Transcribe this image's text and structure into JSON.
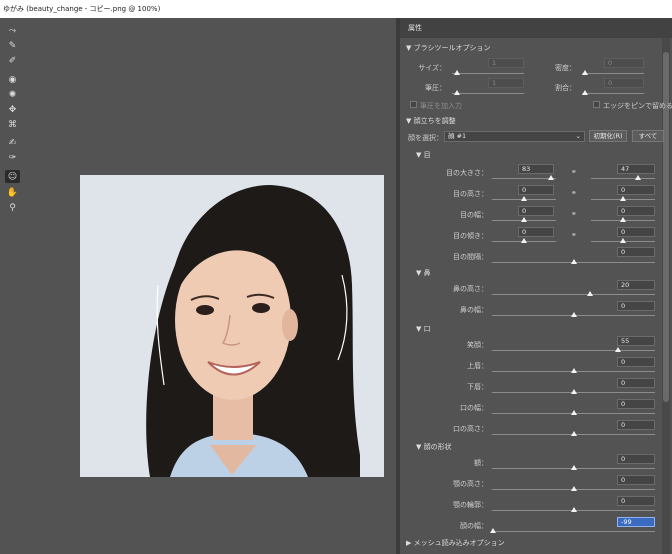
{
  "window": {
    "title": "ゆがみ (beauty_change - コピー.png @ 100%)"
  },
  "tools": [
    {
      "name": "forward-warp-icon",
      "glyph": "⤳"
    },
    {
      "name": "reconstruct-icon",
      "glyph": "✎"
    },
    {
      "name": "smooth-icon",
      "glyph": "✐"
    },
    {
      "name": "twirl-icon",
      "glyph": "◉"
    },
    {
      "name": "pucker-icon",
      "glyph": "✺"
    },
    {
      "name": "bloat-icon",
      "glyph": "✥"
    },
    {
      "name": "push-left-icon",
      "glyph": "⌘"
    },
    {
      "name": "freeze-mask-icon",
      "glyph": "✍"
    },
    {
      "name": "thaw-mask-icon",
      "glyph": "✑"
    },
    {
      "name": "face-tool-icon",
      "glyph": "☺"
    },
    {
      "name": "hand-icon",
      "glyph": "✋"
    },
    {
      "name": "zoom-icon",
      "glyph": "⚲"
    }
  ],
  "panel": {
    "title": "属性",
    "brush": {
      "title": "▼ ブラシツールオプション",
      "size_label": "サイズ：",
      "size_value": "1",
      "density_label": "密度：",
      "density_value": "0",
      "pressure_label": "筆圧：",
      "pressure_value": "1",
      "rate_label": "割合：",
      "rate_value": "0",
      "stylus_label": "筆圧を加入力",
      "pin_edges_label": "エッジをピンで留める"
    },
    "face": {
      "title": "▼ 顔立ちを調整",
      "select_label": "顔を選択：",
      "select_value": "顔 #1",
      "reset_label": "初期化(R)",
      "all_label": "すべて",
      "eyes": {
        "title": "▼ 目",
        "rows": [
          {
            "label": "目の大きさ：",
            "left": "83",
            "right": "47"
          },
          {
            "label": "目の高さ：",
            "left": "0",
            "right": "0"
          },
          {
            "label": "目の幅：",
            "left": "0",
            "right": "0"
          },
          {
            "label": "目の傾き：",
            "left": "0",
            "right": "0"
          }
        ],
        "distance_label": "目の間隔：",
        "distance_value": "0"
      },
      "nose": {
        "title": "▼ 鼻",
        "rows": [
          {
            "label": "鼻の高さ：",
            "value": "20"
          },
          {
            "label": "鼻の幅：",
            "value": "0"
          }
        ]
      },
      "mouth": {
        "title": "▼ 口",
        "rows": [
          {
            "label": "笑顔：",
            "value": "55"
          },
          {
            "label": "上唇：",
            "value": "0"
          },
          {
            "label": "下唇：",
            "value": "0"
          },
          {
            "label": "口の幅：",
            "value": "0"
          },
          {
            "label": "口の高さ：",
            "value": "0"
          }
        ]
      },
      "shape": {
        "title": "▼ 顔の形状",
        "rows": [
          {
            "label": "額：",
            "value": "0"
          },
          {
            "label": "顎の高さ：",
            "value": "0"
          },
          {
            "label": "顎の輪郭：",
            "value": "0"
          },
          {
            "label": "顔の幅：",
            "value": "-99"
          }
        ]
      }
    },
    "mesh": {
      "title": "▶ メッシュ読み込みオプション"
    }
  }
}
